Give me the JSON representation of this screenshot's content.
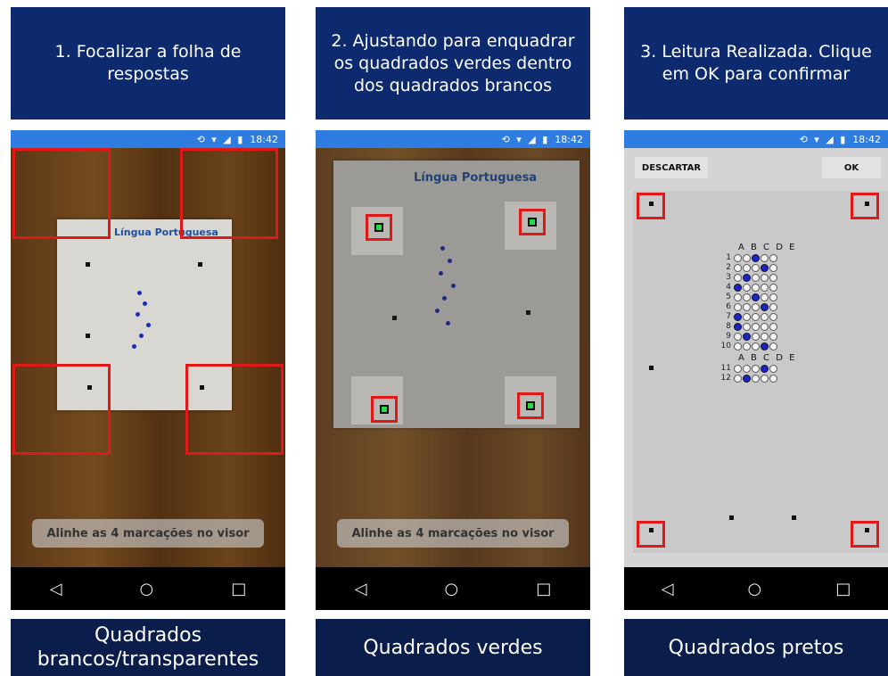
{
  "panels": [
    {
      "header": "1. Focalizar a folha de respostas",
      "status_time": "18:42",
      "sheet_title": "Língua Portuguesa",
      "toast": "Alinhe as 4 marcações no visor",
      "footer": "Quadrados brancos/transparentes"
    },
    {
      "header": "2. Ajustando para enquadrar os  quadrados verdes dentro dos quadrados brancos",
      "status_time": "18:42",
      "sheet_title": "Língua Portuguesa",
      "toast": "Alinhe as 4 marcações no visor",
      "footer": "Quadrados verdes"
    },
    {
      "header": "3. Leitura Realizada. Clique em OK para confirmar",
      "status_time": "18:42",
      "discard_label": "DESCARTAR",
      "ok_label": "OK",
      "letters": "A B C D E",
      "rows": [
        "1",
        "2",
        "3",
        "4",
        "5",
        "6",
        "7",
        "8",
        "9",
        "10"
      ],
      "rows2": [
        "11",
        "12"
      ],
      "footer": "Quadrados pretos"
    }
  ],
  "nav_icons": [
    "back-icon",
    "home-icon",
    "recents-icon"
  ],
  "colors": {
    "header_bg": "#0e2a6e",
    "footer_bg": "#0b1e4b",
    "status_bg": "#2f7de1",
    "red_marker": "#e01818",
    "green_marker": "#2bdc3b",
    "bubble_fill": "#1a24c8"
  }
}
